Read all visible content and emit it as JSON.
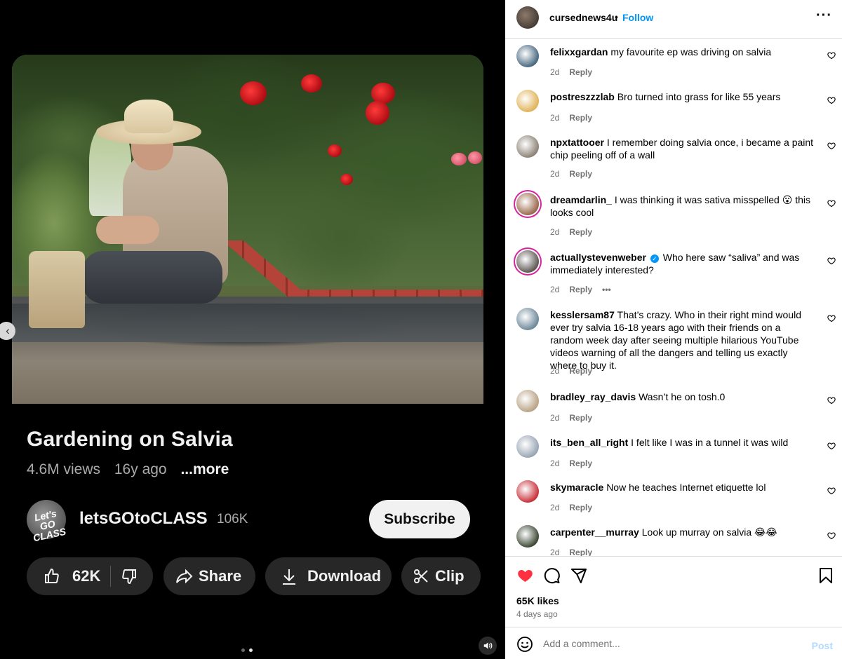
{
  "video": {
    "title": "Gardening on Salvia",
    "views": "4.6M views",
    "age": "16y ago",
    "more": "...more",
    "channel_avatar_text": "Let's GO CLASS",
    "channel_name": "letsGOtoCLASS",
    "subscribers": "106K",
    "subscribe_label": "Subscribe",
    "like_count": "62K",
    "share_label": "Share",
    "download_label": "Download",
    "clip_label": "Clip",
    "carousel_pages": 2,
    "carousel_active": 2
  },
  "post": {
    "owner": "cursednews4u",
    "dot": "•",
    "follow_label": "Follow",
    "more_icon": "more-horizontal-icon",
    "likes": "65K likes",
    "age": "4 days ago",
    "liked": true,
    "accent_color": "#0095f6",
    "heart_color": "#ff3040"
  },
  "comments": [
    {
      "user": "felixxgardan",
      "text": "my favourite ep was driving on salvia",
      "age": "2d",
      "reply": "Reply",
      "verified": false,
      "story": false,
      "avatar_color": "#4a6a82"
    },
    {
      "user": "postreszzzlab",
      "text": "Bro turned into grass for like 55 years",
      "age": "2d",
      "reply": "Reply",
      "verified": false,
      "story": false,
      "avatar_color": "#e0b45a"
    },
    {
      "user": "npxtattooer",
      "text": "I remember doing salvia once, i became a paint chip peeling off of a wall",
      "age": "2d",
      "reply": "Reply",
      "verified": false,
      "story": false,
      "avatar_color": "#8d8478"
    },
    {
      "user": "dreamdarlin_",
      "text": "I was thinking it was sativa misspelled 😮 this looks cool",
      "age": "2d",
      "reply": "Reply",
      "verified": false,
      "story": true,
      "avatar_color": "#9b6a4e"
    },
    {
      "user": "actuallystevenweber",
      "text": "Who here saw “saliva” and was immediately interested?",
      "age": "2d",
      "reply": "Reply",
      "more": "•••",
      "verified": true,
      "story": true,
      "avatar_color": "#5f5a56"
    },
    {
      "user": "kesslersam87",
      "text": "That’s crazy. Who in their right mind would ever try salvia 16-18 years ago with their friends on a random week day after seeing multiple hilarious YouTube videos warning of all the dangers and telling us exactly where to buy it.",
      "age": "2d",
      "reply": "Reply",
      "verified": false,
      "story": false,
      "avatar_color": "#6f8a9a"
    },
    {
      "user": "bradley_ray_davis",
      "text": "Wasn’t he on tosh.0",
      "age": "2d",
      "reply": "Reply",
      "verified": false,
      "story": false,
      "avatar_color": "#b9a486"
    },
    {
      "user": "its_ben_all_right",
      "text": "I felt like I was in a tunnel it was wild",
      "age": "2d",
      "reply": "Reply",
      "verified": false,
      "story": false,
      "avatar_color": "#9aa6b5"
    },
    {
      "user": "skymaracle",
      "text": "Now he teaches Internet etiquette lol",
      "age": "2d",
      "reply": "Reply",
      "verified": false,
      "story": false,
      "avatar_color": "#c8333b"
    },
    {
      "user": "carpenter__murray",
      "text": "Look up murray on salvia 😂😂",
      "age": "2d",
      "reply": "Reply",
      "verified": false,
      "story": false,
      "avatar_color": "#3f4a38"
    }
  ],
  "composer": {
    "placeholder": "Add a comment...",
    "post_label": "Post"
  }
}
